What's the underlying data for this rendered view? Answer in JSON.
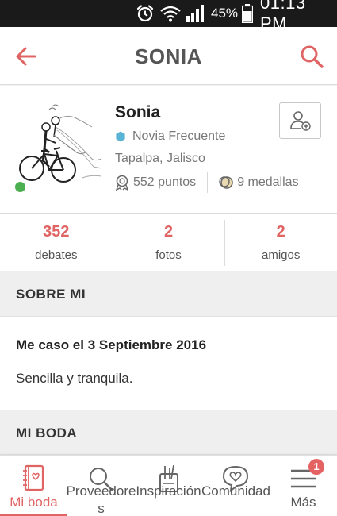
{
  "status_bar": {
    "battery_percent": "45%",
    "time": "01:13 PM",
    "icons": [
      "alarm-icon",
      "wifi-icon",
      "signal-icon",
      "battery-icon"
    ]
  },
  "header": {
    "title": "SONIA",
    "back_icon": "back-arrow-icon",
    "search_icon": "search-icon"
  },
  "profile": {
    "name": "Sonia",
    "level": "Novia Frecuente",
    "location": "Tapalpa, Jalisco",
    "points": "552 puntos",
    "medals": "9 medallas",
    "online": true,
    "add_friend_icon": "add-friend-icon"
  },
  "counters": [
    {
      "value": "352",
      "label": "debates"
    },
    {
      "value": "2",
      "label": "fotos"
    },
    {
      "value": "2",
      "label": "amigos"
    }
  ],
  "sections": {
    "about": {
      "header": "SOBRE MI",
      "title": "Me caso el 3 Septiembre 2016",
      "text": "Sencilla y tranquila."
    },
    "wedding": {
      "header": "MI BODA"
    }
  },
  "bottom_nav": {
    "items": [
      {
        "label": "Mi boda",
        "icon": "notebook-icon",
        "active": true
      },
      {
        "label": "Proveedores",
        "icon": "search-icon",
        "active": false
      },
      {
        "label": "Inspiración",
        "icon": "inspiration-icon",
        "active": false
      },
      {
        "label": "Comunidad",
        "icon": "community-icon",
        "active": false
      },
      {
        "label": "Más",
        "icon": "menu-icon",
        "active": false
      }
    ],
    "more_badge": "1"
  },
  "colors": {
    "accent": "#e06464",
    "online": "#4caf50",
    "level_hex": "#5ab4d6",
    "section_bg": "#efefef",
    "status_bar_bg": "#1a1a1a"
  }
}
